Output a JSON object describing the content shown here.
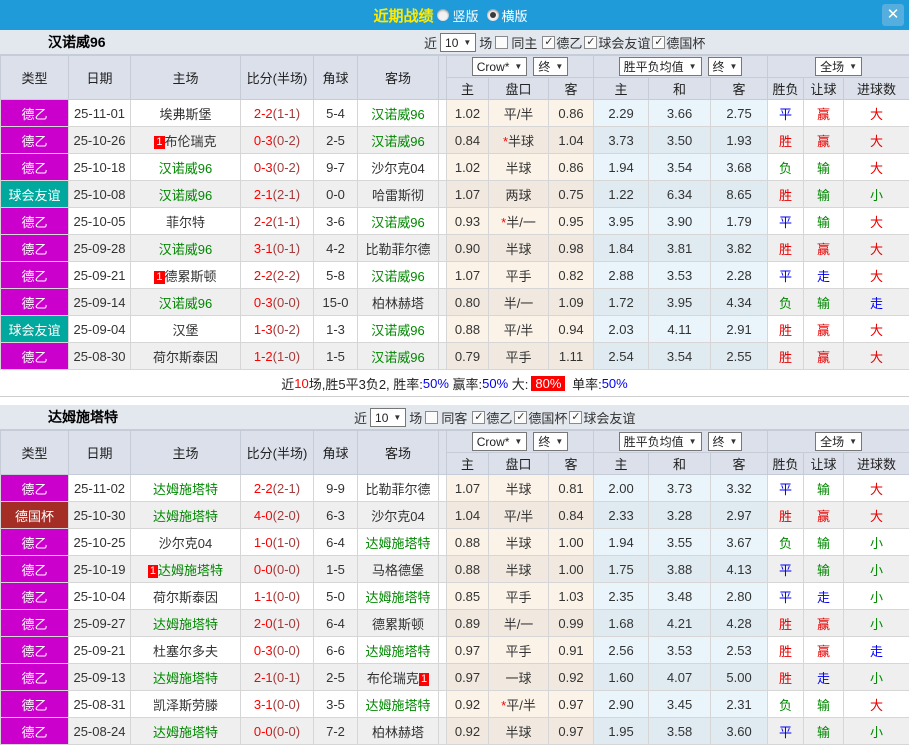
{
  "topbar": {
    "title": "近期战绩",
    "radios": [
      {
        "label": "竖版",
        "checked": false
      },
      {
        "label": "横版",
        "checked": true
      }
    ],
    "close_icon": "✕"
  },
  "colors": {
    "topbar_blue": "#1e9bd8",
    "title_yellow": "#ffea00",
    "league_de2_magenta": "#cc00cc",
    "league_friendly_teal": "#00a89e",
    "league_cup_darkred": "#a42d25",
    "self_team_green": "#008800",
    "win_red": "#e60000",
    "draw_blue": "#0000ee",
    "lose_green": "#008800",
    "score_red": "#ff0000",
    "odds_cream_bg": "#fbf3e8",
    "avg_blue_bg": "#e9f4fb"
  },
  "header": {
    "cols_left": [
      "类型",
      "日期",
      "主场",
      "比分(半场)",
      "角球",
      "客场"
    ],
    "dd_crow": "Crow*",
    "dd_end1": "终",
    "dd_avg": "胜平负均值",
    "dd_end2": "终",
    "dd_full": "全场",
    "cols_odds": [
      "主",
      "盘口",
      "客"
    ],
    "cols_avg": [
      "主",
      "和",
      "客"
    ],
    "cols_result": [
      "胜负",
      "让球",
      "进球数"
    ]
  },
  "tables": [
    {
      "team": "汉诺威96",
      "filter": {
        "near": "近",
        "count": "10",
        "games": "场",
        "same": {
          "label": "同主",
          "checked": false
        },
        "leagues": [
          {
            "label": "德乙",
            "checked": true
          },
          {
            "label": "球会友谊",
            "checked": true
          },
          {
            "label": "德国杯",
            "checked": true
          }
        ]
      },
      "rows": [
        {
          "lg": "德乙",
          "date": "25-11-01",
          "home": "埃弗斯堡",
          "home_self": false,
          "home_badge": "",
          "score": "2-2",
          "half": "(1-1)",
          "corner": "5-4",
          "away": "汉诺威96",
          "away_self": true,
          "away_badge": "",
          "h": "1.02",
          "pan": "平/半",
          "a": "0.86",
          "m1": "2.29",
          "m2": "3.66",
          "m3": "2.75",
          "r1": "平",
          "r2": "赢",
          "r3": "大"
        },
        {
          "lg": "德乙",
          "date": "25-10-26",
          "home": "布伦瑞克",
          "home_self": false,
          "home_badge": "1",
          "score": "0-3",
          "half": "(0-2)",
          "corner": "2-5",
          "away": "汉诺威96",
          "away_self": true,
          "away_badge": "",
          "h": "0.84",
          "pan": "*半球",
          "a": "1.04",
          "m1": "3.73",
          "m2": "3.50",
          "m3": "1.93",
          "r1": "胜",
          "r2": "赢",
          "r3": "大"
        },
        {
          "lg": "德乙",
          "date": "25-10-18",
          "home": "汉诺威96",
          "home_self": true,
          "home_badge": "",
          "score": "0-3",
          "half": "(0-2)",
          "corner": "9-7",
          "away": "沙尔克04",
          "away_self": false,
          "away_badge": "",
          "h": "1.02",
          "pan": "半球",
          "a": "0.86",
          "m1": "1.94",
          "m2": "3.54",
          "m3": "3.68",
          "r1": "负",
          "r2": "输",
          "r3": "大"
        },
        {
          "lg": "球会友谊",
          "date": "25-10-08",
          "home": "汉诺威96",
          "home_self": true,
          "home_badge": "",
          "score": "2-1",
          "half": "(2-1)",
          "corner": "0-0",
          "away": "哈雷斯彻",
          "away_self": false,
          "away_badge": "",
          "h": "1.07",
          "pan": "两球",
          "a": "0.75",
          "m1": "1.22",
          "m2": "6.34",
          "m3": "8.65",
          "r1": "胜",
          "r2": "输",
          "r3": "小"
        },
        {
          "lg": "德乙",
          "date": "25-10-05",
          "home": "菲尔特",
          "home_self": false,
          "home_badge": "",
          "score": "2-2",
          "half": "(1-1)",
          "corner": "3-6",
          "away": "汉诺威96",
          "away_self": true,
          "away_badge": "",
          "h": "0.93",
          "pan": "*半/一",
          "a": "0.95",
          "m1": "3.95",
          "m2": "3.90",
          "m3": "1.79",
          "r1": "平",
          "r2": "输",
          "r3": "大"
        },
        {
          "lg": "德乙",
          "date": "25-09-28",
          "home": "汉诺威96",
          "home_self": true,
          "home_badge": "",
          "score": "3-1",
          "half": "(0-1)",
          "corner": "4-2",
          "away": "比勒菲尔德",
          "away_self": false,
          "away_badge": "",
          "h": "0.90",
          "pan": "半球",
          "a": "0.98",
          "m1": "1.84",
          "m2": "3.81",
          "m3": "3.82",
          "r1": "胜",
          "r2": "赢",
          "r3": "大"
        },
        {
          "lg": "德乙",
          "date": "25-09-21",
          "home": "德累斯顿",
          "home_self": false,
          "home_badge": "1",
          "score": "2-2",
          "half": "(2-2)",
          "corner": "5-8",
          "away": "汉诺威96",
          "away_self": true,
          "away_badge": "",
          "h": "1.07",
          "pan": "平手",
          "a": "0.82",
          "m1": "2.88",
          "m2": "3.53",
          "m3": "2.28",
          "r1": "平",
          "r2": "走",
          "r3": "大"
        },
        {
          "lg": "德乙",
          "date": "25-09-14",
          "home": "汉诺威96",
          "home_self": true,
          "home_badge": "",
          "score": "0-3",
          "half": "(0-0)",
          "corner": "15-0",
          "away": "柏林赫塔",
          "away_self": false,
          "away_badge": "",
          "h": "0.80",
          "pan": "半/一",
          "a": "1.09",
          "m1": "1.72",
          "m2": "3.95",
          "m3": "4.34",
          "r1": "负",
          "r2": "输",
          "r3": "走"
        },
        {
          "lg": "球会友谊",
          "date": "25-09-04",
          "home": "汉堡",
          "home_self": false,
          "home_badge": "",
          "score": "1-3",
          "half": "(0-2)",
          "corner": "1-3",
          "away": "汉诺威96",
          "away_self": true,
          "away_badge": "",
          "h": "0.88",
          "pan": "平/半",
          "a": "0.94",
          "m1": "2.03",
          "m2": "4.11",
          "m3": "2.91",
          "r1": "胜",
          "r2": "赢",
          "r3": "大"
        },
        {
          "lg": "德乙",
          "date": "25-08-30",
          "home": "荷尔斯泰因",
          "home_self": false,
          "home_badge": "",
          "score": "1-2",
          "half": "(1-0)",
          "corner": "1-5",
          "away": "汉诺威96",
          "away_self": true,
          "away_badge": "",
          "h": "0.79",
          "pan": "平手",
          "a": "1.11",
          "m1": "2.54",
          "m2": "3.54",
          "m3": "2.55",
          "r1": "胜",
          "r2": "赢",
          "r3": "大"
        }
      ],
      "summary": [
        {
          "t": "近",
          "s": "p"
        },
        {
          "t": "10",
          "s": "r"
        },
        {
          "t": "场,胜5平3负2, 胜率:",
          "s": "p"
        },
        {
          "t": "50%",
          "s": "b"
        },
        {
          "t": " 赢率:",
          "s": "p"
        },
        {
          "t": "50%",
          "s": "b"
        },
        {
          "t": " 大:",
          "s": "p"
        },
        {
          "t": "80%",
          "s": "rb"
        },
        {
          "t": " 单率:",
          "s": "p"
        },
        {
          "t": "50%",
          "s": "b"
        }
      ]
    },
    {
      "team": "达姆施塔特",
      "filter": {
        "near": "近",
        "count": "10",
        "games": "场",
        "same": {
          "label": "同客",
          "checked": false
        },
        "leagues": [
          {
            "label": "德乙",
            "checked": true
          },
          {
            "label": "德国杯",
            "checked": true
          },
          {
            "label": "球会友谊",
            "checked": true
          }
        ]
      },
      "rows": [
        {
          "lg": "德乙",
          "date": "25-11-02",
          "home": "达姆施塔特",
          "home_self": true,
          "home_badge": "",
          "score": "2-2",
          "half": "(2-1)",
          "corner": "9-9",
          "away": "比勒菲尔德",
          "away_self": false,
          "away_badge": "",
          "h": "1.07",
          "pan": "半球",
          "a": "0.81",
          "m1": "2.00",
          "m2": "3.73",
          "m3": "3.32",
          "r1": "平",
          "r2": "输",
          "r3": "大"
        },
        {
          "lg": "德国杯",
          "date": "25-10-30",
          "home": "达姆施塔特",
          "home_self": true,
          "home_badge": "",
          "score": "4-0",
          "half": "(2-0)",
          "corner": "6-3",
          "away": "沙尔克04",
          "away_self": false,
          "away_badge": "",
          "h": "1.04",
          "pan": "平/半",
          "a": "0.84",
          "m1": "2.33",
          "m2": "3.28",
          "m3": "2.97",
          "r1": "胜",
          "r2": "赢",
          "r3": "大"
        },
        {
          "lg": "德乙",
          "date": "25-10-25",
          "home": "沙尔克04",
          "home_self": false,
          "home_badge": "",
          "score": "1-0",
          "half": "(1-0)",
          "corner": "6-4",
          "away": "达姆施塔特",
          "away_self": true,
          "away_badge": "",
          "h": "0.88",
          "pan": "半球",
          "a": "1.00",
          "m1": "1.94",
          "m2": "3.55",
          "m3": "3.67",
          "r1": "负",
          "r2": "输",
          "r3": "小"
        },
        {
          "lg": "德乙",
          "date": "25-10-19",
          "home": "达姆施塔特",
          "home_self": true,
          "home_badge": "1",
          "score": "0-0",
          "half": "(0-0)",
          "corner": "1-5",
          "away": "马格德堡",
          "away_self": false,
          "away_badge": "",
          "h": "0.88",
          "pan": "半球",
          "a": "1.00",
          "m1": "1.75",
          "m2": "3.88",
          "m3": "4.13",
          "r1": "平",
          "r2": "输",
          "r3": "小"
        },
        {
          "lg": "德乙",
          "date": "25-10-04",
          "home": "荷尔斯泰因",
          "home_self": false,
          "home_badge": "",
          "score": "1-1",
          "half": "(0-0)",
          "corner": "5-0",
          "away": "达姆施塔特",
          "away_self": true,
          "away_badge": "",
          "h": "0.85",
          "pan": "平手",
          "a": "1.03",
          "m1": "2.35",
          "m2": "3.48",
          "m3": "2.80",
          "r1": "平",
          "r2": "走",
          "r3": "小"
        },
        {
          "lg": "德乙",
          "date": "25-09-27",
          "home": "达姆施塔特",
          "home_self": true,
          "home_badge": "",
          "score": "2-0",
          "half": "(1-0)",
          "corner": "6-4",
          "away": "德累斯顿",
          "away_self": false,
          "away_badge": "",
          "h": "0.89",
          "pan": "半/一",
          "a": "0.99",
          "m1": "1.68",
          "m2": "4.21",
          "m3": "4.28",
          "r1": "胜",
          "r2": "赢",
          "r3": "小"
        },
        {
          "lg": "德乙",
          "date": "25-09-21",
          "home": "杜塞尔多夫",
          "home_self": false,
          "home_badge": "",
          "score": "0-3",
          "half": "(0-0)",
          "corner": "6-6",
          "away": "达姆施塔特",
          "away_self": true,
          "away_badge": "",
          "h": "0.97",
          "pan": "平手",
          "a": "0.91",
          "m1": "2.56",
          "m2": "3.53",
          "m3": "2.53",
          "r1": "胜",
          "r2": "赢",
          "r3": "走"
        },
        {
          "lg": "德乙",
          "date": "25-09-13",
          "home": "达姆施塔特",
          "home_self": true,
          "home_badge": "",
          "score": "2-1",
          "half": "(0-1)",
          "corner": "2-5",
          "away": "布伦瑞克",
          "away_self": false,
          "away_badge": "1",
          "h": "0.97",
          "pan": "一球",
          "a": "0.92",
          "m1": "1.60",
          "m2": "4.07",
          "m3": "5.00",
          "r1": "胜",
          "r2": "走",
          "r3": "小"
        },
        {
          "lg": "德乙",
          "date": "25-08-31",
          "home": "凯泽斯劳滕",
          "home_self": false,
          "home_badge": "",
          "score": "3-1",
          "half": "(0-0)",
          "corner": "3-5",
          "away": "达姆施塔特",
          "away_self": true,
          "away_badge": "",
          "h": "0.92",
          "pan": "*平/半",
          "a": "0.97",
          "m1": "2.90",
          "m2": "3.45",
          "m3": "2.31",
          "r1": "负",
          "r2": "输",
          "r3": "大"
        },
        {
          "lg": "德乙",
          "date": "25-08-24",
          "home": "达姆施塔特",
          "home_self": true,
          "home_badge": "",
          "score": "0-0",
          "half": "(0-0)",
          "corner": "7-2",
          "away": "柏林赫塔",
          "away_self": false,
          "away_badge": "",
          "h": "0.92",
          "pan": "半球",
          "a": "0.97",
          "m1": "1.95",
          "m2": "3.58",
          "m3": "3.60",
          "r1": "平",
          "r2": "输",
          "r3": "小"
        }
      ],
      "summary": []
    }
  ]
}
